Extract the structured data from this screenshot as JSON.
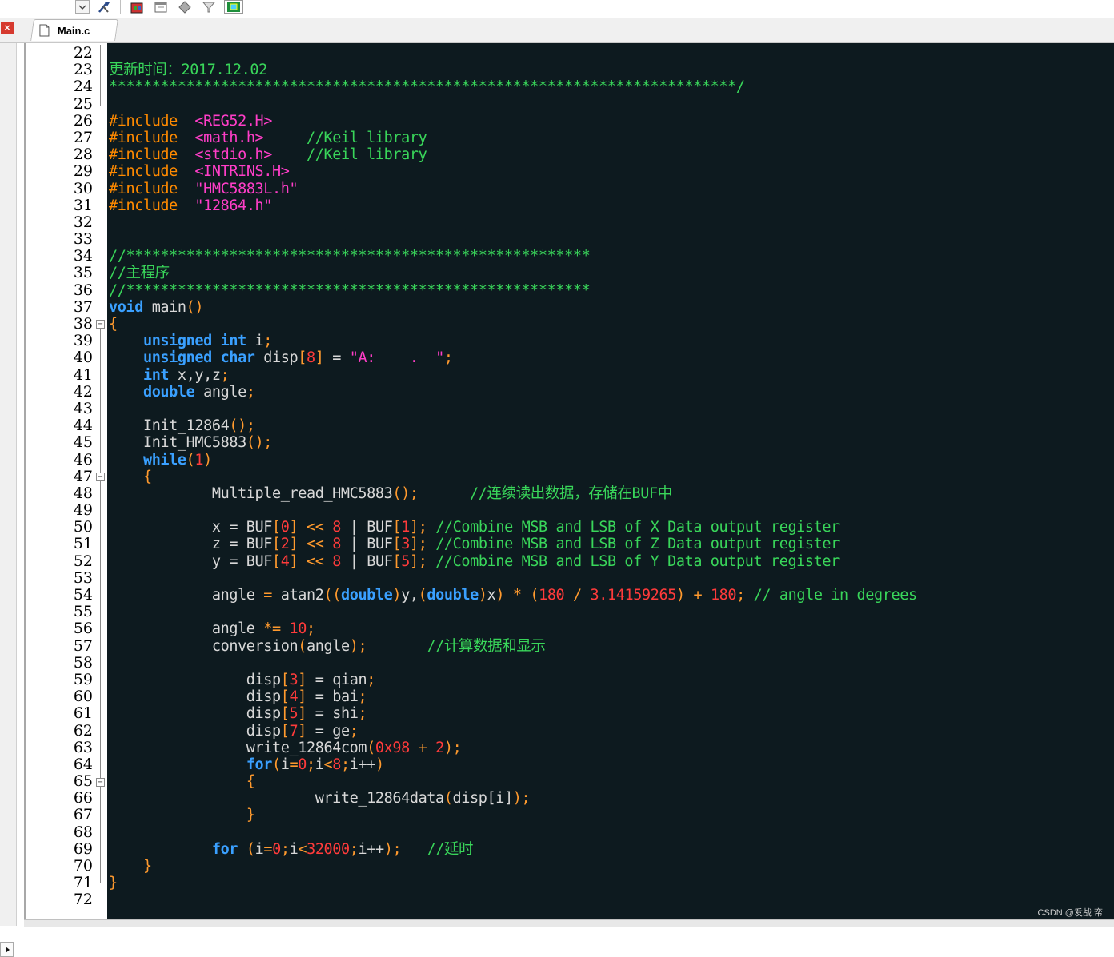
{
  "tab": {
    "label": "Main.c"
  },
  "icons": [
    "dropdown-icon",
    "tools-icon",
    "build-icon",
    "window-icon",
    "diamond-icon",
    "funnel-icon",
    "chip-icon"
  ],
  "watermark": "CSDN @叐战 帟",
  "editor": {
    "first_line_number": 22,
    "lines": [
      [],
      [
        [
          "cm",
          "更新时间：2017.12.02"
        ]
      ],
      [
        [
          "cm",
          "*************************************************************************/"
        ]
      ],
      [],
      [
        [
          "pp",
          "#include  "
        ],
        [
          "str",
          "<REG52.H>"
        ]
      ],
      [
        [
          "pp",
          "#include  "
        ],
        [
          "str",
          "<math.h>"
        ],
        [
          "t",
          "     "
        ],
        [
          "cm",
          "//Keil library"
        ]
      ],
      [
        [
          "pp",
          "#include  "
        ],
        [
          "str",
          "<stdio.h>"
        ],
        [
          "t",
          "    "
        ],
        [
          "cm",
          "//Keil library"
        ]
      ],
      [
        [
          "pp",
          "#include  "
        ],
        [
          "str",
          "<INTRINS.H>"
        ]
      ],
      [
        [
          "pp",
          "#include  "
        ],
        [
          "str",
          "\"HMC5883L.h\""
        ]
      ],
      [
        [
          "pp",
          "#include  "
        ],
        [
          "str",
          "\"12864.h\""
        ]
      ],
      [],
      [],
      [
        [
          "cm",
          "//******************************************************"
        ]
      ],
      [
        [
          "cm",
          "//主程序"
        ]
      ],
      [
        [
          "cm",
          "//******************************************************"
        ]
      ],
      [
        [
          "kw",
          "void"
        ],
        [
          "t",
          " main"
        ],
        [
          "op",
          "()"
        ]
      ],
      [
        [
          "op",
          "{"
        ]
      ],
      [
        [
          "t",
          "    "
        ],
        [
          "kw",
          "unsigned int"
        ],
        [
          "t",
          " i"
        ],
        [
          "op",
          ";"
        ]
      ],
      [
        [
          "t",
          "    "
        ],
        [
          "kw",
          "unsigned char"
        ],
        [
          "t",
          " disp"
        ],
        [
          "op",
          "["
        ],
        [
          "num",
          "8"
        ],
        [
          "op",
          "]"
        ],
        [
          "t",
          " = "
        ],
        [
          "str",
          "\"A:    .  \""
        ],
        [
          "op",
          ";"
        ]
      ],
      [
        [
          "t",
          "    "
        ],
        [
          "kw",
          "int"
        ],
        [
          "t",
          " x,y,z"
        ],
        [
          "op",
          ";"
        ]
      ],
      [
        [
          "t",
          "    "
        ],
        [
          "kw",
          "double"
        ],
        [
          "t",
          " angle"
        ],
        [
          "op",
          ";"
        ]
      ],
      [],
      [
        [
          "t",
          "    Init_12864"
        ],
        [
          "op",
          "();"
        ]
      ],
      [
        [
          "t",
          "    Init_HMC5883"
        ],
        [
          "op",
          "();"
        ]
      ],
      [
        [
          "t",
          "    "
        ],
        [
          "kw",
          "while"
        ],
        [
          "op",
          "("
        ],
        [
          "num",
          "1"
        ],
        [
          "op",
          ")"
        ]
      ],
      [
        [
          "t",
          "    "
        ],
        [
          "op",
          "{"
        ]
      ],
      [
        [
          "t",
          "            Multiple_read_HMC5883"
        ],
        [
          "op",
          "();"
        ],
        [
          "t",
          "      "
        ],
        [
          "cm",
          "//连续读出数据，存储在BUF中"
        ]
      ],
      [],
      [
        [
          "t",
          "            x = BUF"
        ],
        [
          "op",
          "["
        ],
        [
          "num",
          "0"
        ],
        [
          "op",
          "]"
        ],
        [
          "t",
          " "
        ],
        [
          "op",
          "<<"
        ],
        [
          "t",
          " "
        ],
        [
          "num",
          "8"
        ],
        [
          "t",
          " | BUF"
        ],
        [
          "op",
          "["
        ],
        [
          "num",
          "1"
        ],
        [
          "op",
          "];"
        ],
        [
          "t",
          " "
        ],
        [
          "cm",
          "//Combine MSB and LSB of X Data output register"
        ]
      ],
      [
        [
          "t",
          "            z = BUF"
        ],
        [
          "op",
          "["
        ],
        [
          "num",
          "2"
        ],
        [
          "op",
          "]"
        ],
        [
          "t",
          " "
        ],
        [
          "op",
          "<<"
        ],
        [
          "t",
          " "
        ],
        [
          "num",
          "8"
        ],
        [
          "t",
          " | BUF"
        ],
        [
          "op",
          "["
        ],
        [
          "num",
          "3"
        ],
        [
          "op",
          "];"
        ],
        [
          "t",
          " "
        ],
        [
          "cm",
          "//Combine MSB and LSB of Z Data output register"
        ]
      ],
      [
        [
          "t",
          "            y = BUF"
        ],
        [
          "op",
          "["
        ],
        [
          "num",
          "4"
        ],
        [
          "op",
          "]"
        ],
        [
          "t",
          " "
        ],
        [
          "op",
          "<<"
        ],
        [
          "t",
          " "
        ],
        [
          "num",
          "8"
        ],
        [
          "t",
          " | BUF"
        ],
        [
          "op",
          "["
        ],
        [
          "num",
          "5"
        ],
        [
          "op",
          "];"
        ],
        [
          "t",
          " "
        ],
        [
          "cm",
          "//Combine MSB and LSB of Y Data output register"
        ]
      ],
      [],
      [
        [
          "t",
          "            angle "
        ],
        [
          "op",
          "="
        ],
        [
          "t",
          " atan2"
        ],
        [
          "op",
          "(("
        ],
        [
          "kw",
          "double"
        ],
        [
          "op",
          ")"
        ],
        [
          "t",
          "y,"
        ],
        [
          "op",
          "("
        ],
        [
          "kw",
          "double"
        ],
        [
          "op",
          ")"
        ],
        [
          "t",
          "x"
        ],
        [
          "op",
          ")"
        ],
        [
          "t",
          " "
        ],
        [
          "op",
          "*"
        ],
        [
          "t",
          " "
        ],
        [
          "op",
          "("
        ],
        [
          "num",
          "180"
        ],
        [
          "t",
          " "
        ],
        [
          "op",
          "/"
        ],
        [
          "t",
          " "
        ],
        [
          "num",
          "3.14159265"
        ],
        [
          "op",
          ")"
        ],
        [
          "t",
          " "
        ],
        [
          "op",
          "+"
        ],
        [
          "t",
          " "
        ],
        [
          "num",
          "180"
        ],
        [
          "op",
          ";"
        ],
        [
          "t",
          " "
        ],
        [
          "cm",
          "// angle in degrees"
        ]
      ],
      [],
      [
        [
          "t",
          "            angle "
        ],
        [
          "op",
          "*="
        ],
        [
          "t",
          " "
        ],
        [
          "num",
          "10"
        ],
        [
          "op",
          ";"
        ]
      ],
      [
        [
          "t",
          "            conversion"
        ],
        [
          "op",
          "("
        ],
        [
          "t",
          "angle"
        ],
        [
          "op",
          ");"
        ],
        [
          "t",
          "       "
        ],
        [
          "cm",
          "//计算数据和显示"
        ]
      ],
      [],
      [
        [
          "t",
          "                disp"
        ],
        [
          "op",
          "["
        ],
        [
          "num",
          "3"
        ],
        [
          "op",
          "]"
        ],
        [
          "t",
          " = qian"
        ],
        [
          "op",
          ";"
        ]
      ],
      [
        [
          "t",
          "                disp"
        ],
        [
          "op",
          "["
        ],
        [
          "num",
          "4"
        ],
        [
          "op",
          "]"
        ],
        [
          "t",
          " = bai"
        ],
        [
          "op",
          ";"
        ]
      ],
      [
        [
          "t",
          "                disp"
        ],
        [
          "op",
          "["
        ],
        [
          "num",
          "5"
        ],
        [
          "op",
          "]"
        ],
        [
          "t",
          " = shi"
        ],
        [
          "op",
          ";"
        ]
      ],
      [
        [
          "t",
          "                disp"
        ],
        [
          "op",
          "["
        ],
        [
          "num",
          "7"
        ],
        [
          "op",
          "]"
        ],
        [
          "t",
          " = ge"
        ],
        [
          "op",
          ";"
        ]
      ],
      [
        [
          "t",
          "                write_12864com"
        ],
        [
          "op",
          "("
        ],
        [
          "num",
          "0x98"
        ],
        [
          "t",
          " "
        ],
        [
          "op",
          "+"
        ],
        [
          "t",
          " "
        ],
        [
          "num",
          "2"
        ],
        [
          "op",
          ");"
        ]
      ],
      [
        [
          "t",
          "                "
        ],
        [
          "kw",
          "for"
        ],
        [
          "op",
          "("
        ],
        [
          "t",
          "i"
        ],
        [
          "op",
          "="
        ],
        [
          "num",
          "0"
        ],
        [
          "op",
          ";"
        ],
        [
          "t",
          "i"
        ],
        [
          "op",
          "<"
        ],
        [
          "num",
          "8"
        ],
        [
          "op",
          ";"
        ],
        [
          "t",
          "i++"
        ],
        [
          "op",
          ")"
        ]
      ],
      [
        [
          "t",
          "                "
        ],
        [
          "op",
          "{"
        ]
      ],
      [
        [
          "t",
          "                        write_12864data"
        ],
        [
          "op",
          "("
        ],
        [
          "t",
          "disp[i]"
        ],
        [
          "op",
          ");"
        ]
      ],
      [
        [
          "t",
          "                "
        ],
        [
          "op",
          "}"
        ]
      ],
      [],
      [
        [
          "t",
          "            "
        ],
        [
          "kw",
          "for"
        ],
        [
          "t",
          " "
        ],
        [
          "op",
          "("
        ],
        [
          "t",
          "i"
        ],
        [
          "op",
          "="
        ],
        [
          "num",
          "0"
        ],
        [
          "op",
          ";"
        ],
        [
          "t",
          "i"
        ],
        [
          "op",
          "<"
        ],
        [
          "num",
          "32000"
        ],
        [
          "op",
          ";"
        ],
        [
          "t",
          "i++"
        ],
        [
          "op",
          ");"
        ],
        [
          "t",
          "   "
        ],
        [
          "cm",
          "//延时"
        ]
      ],
      [
        [
          "t",
          "    "
        ],
        [
          "op",
          "}"
        ]
      ],
      [
        [
          "op",
          "}"
        ]
      ],
      []
    ]
  }
}
